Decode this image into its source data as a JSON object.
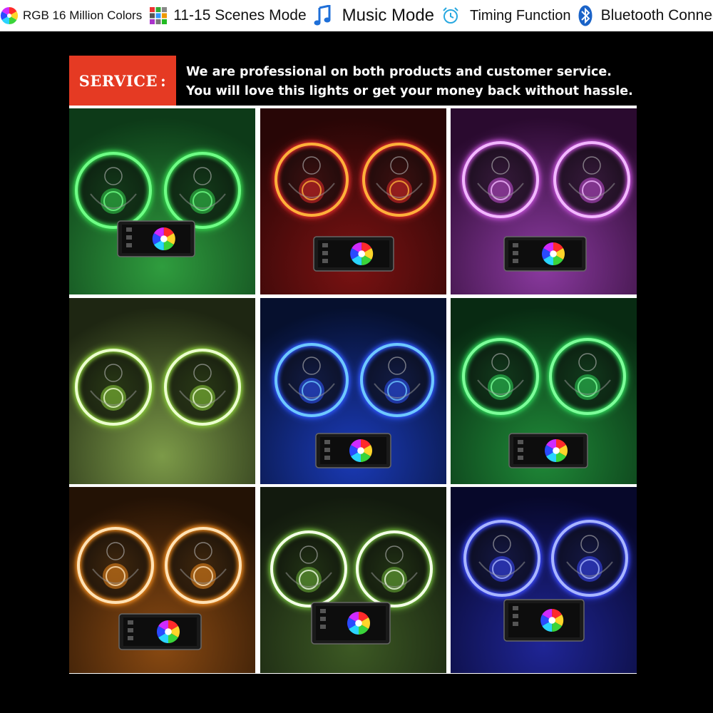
{
  "features": [
    {
      "icon": "color-wheel-icon",
      "label": "RGB 16 Million Colors"
    },
    {
      "icon": "scenes-grid-icon",
      "label": "11-15 Scenes Mode"
    },
    {
      "icon": "music-note-icon",
      "label": "Music Mode"
    },
    {
      "icon": "alarm-clock-icon",
      "label": "Timing Function"
    },
    {
      "icon": "bluetooth-icon",
      "label": "Bluetooth Connection"
    }
  ],
  "banner": {
    "badge": "SERVICE",
    "colon": ":",
    "line1": "We are professional on both products and customer service.",
    "line2": "You will love this lights or get your money back without hassle."
  },
  "colors": {
    "badge_red": "#e53a23",
    "scenes": [
      {
        "bg": "#0d3a18",
        "glow": "#34d24e",
        "ring": "#6fff86",
        "floor": "#2f9d3e"
      },
      {
        "bg": "#280606",
        "glow": "#e02a2a",
        "ring": "#ffb13a",
        "floor": "#7a1212"
      },
      {
        "bg": "#2a0a2f",
        "glow": "#c24fd6",
        "ring": "#f2b8ff",
        "floor": "#8b3aa0"
      },
      {
        "bg": "#1e2612",
        "glow": "#8ccf3a",
        "ring": "#ecffd0",
        "floor": "#7c9a48"
      },
      {
        "bg": "#06102e",
        "glow": "#2f56ff",
        "ring": "#6ec8ff",
        "floor": "#1a3ab8"
      },
      {
        "bg": "#082a12",
        "glow": "#2ed65a",
        "ring": "#7dff9a",
        "floor": "#1f8a38"
      },
      {
        "bg": "#231205",
        "glow": "#f08a1e",
        "ring": "#ffe2b6",
        "floor": "#8a4a12"
      },
      {
        "bg": "#121a0e",
        "glow": "#6fb63a",
        "ring": "#f4ffe8",
        "floor": "#3d5a24"
      },
      {
        "bg": "#07082a",
        "glow": "#3a48ff",
        "ring": "#a9b6ff",
        "floor": "#1f2596"
      }
    ]
  }
}
